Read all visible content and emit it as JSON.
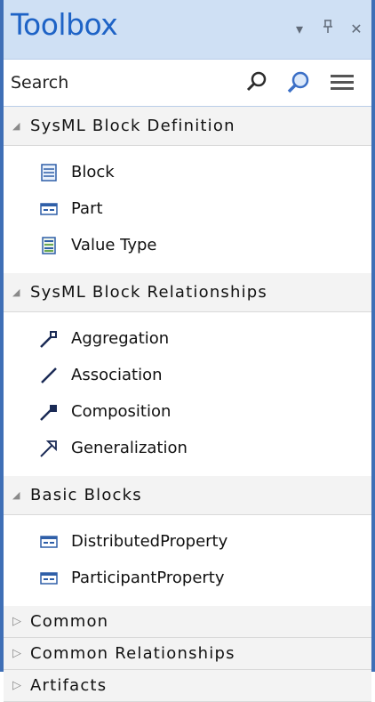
{
  "window": {
    "title": "Toolbox",
    "controls": {
      "menu": "▾",
      "pin": "⊥",
      "close": "✕"
    }
  },
  "search": {
    "placeholder": "Search"
  },
  "colors": {
    "accent": "#3f6fb6",
    "title": "#1e63c6",
    "header_bg": "#cfe0f4",
    "section_bg": "#f3f3f3",
    "icon_blue": "#2f5fa8"
  },
  "sections": [
    {
      "label": "SysML Block Definition",
      "expanded": true,
      "items": [
        {
          "label": "Block",
          "icon": "block-icon"
        },
        {
          "label": "Part",
          "icon": "part-icon"
        },
        {
          "label": "Value Type",
          "icon": "value-type-icon"
        }
      ]
    },
    {
      "label": "SysML Block Relationships",
      "expanded": true,
      "items": [
        {
          "label": "Aggregation",
          "icon": "aggregation-icon"
        },
        {
          "label": "Association",
          "icon": "association-icon"
        },
        {
          "label": "Composition",
          "icon": "composition-icon"
        },
        {
          "label": "Generalization",
          "icon": "generalization-icon"
        }
      ]
    },
    {
      "label": "Basic Blocks",
      "expanded": true,
      "items": [
        {
          "label": "DistributedProperty",
          "icon": "property-icon"
        },
        {
          "label": "ParticipantProperty",
          "icon": "property-icon"
        }
      ]
    },
    {
      "label": "Common",
      "expanded": false,
      "items": []
    },
    {
      "label": "Common Relationships",
      "expanded": false,
      "items": []
    },
    {
      "label": "Artifacts",
      "expanded": false,
      "items": []
    }
  ]
}
